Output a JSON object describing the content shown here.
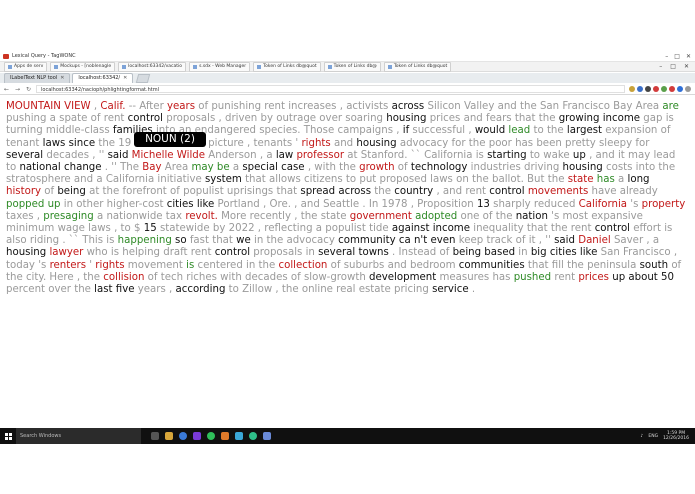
{
  "window": {
    "title": "Lexical Query - TagWONC"
  },
  "bookmarks": [
    {
      "label": "Apps de serv"
    },
    {
      "label": "Mockups - [noblenagle"
    },
    {
      "label": "localhost:63342/vacatio"
    },
    {
      "label": "s.sdx - Web Manager"
    },
    {
      "label": "Token of Links db@quot"
    },
    {
      "label": "Token of Links db@"
    },
    {
      "label": "Token of Links db@quot"
    }
  ],
  "tabs": [
    {
      "label": "lLabelText NLP tool"
    },
    {
      "label": "localhost:63342/"
    }
  ],
  "address": {
    "url": "localhost:63342/nacioph/phlightingformat.html"
  },
  "tooltip": {
    "text": "NOUN (2)"
  },
  "taskbar": {
    "search_placeholder": "Search Windows",
    "time": "1:59 PM",
    "date": "12/26/2016",
    "lang": "ENG"
  },
  "colors": {
    "noun": "#c21818",
    "verb": "#2e8a26",
    "other": "#9a9a9a",
    "key": "#111111"
  },
  "article": {
    "tokens": [
      {
        "t": "MOUNTAIN VIEW",
        "c": "r"
      },
      {
        "t": " , ",
        "c": "g"
      },
      {
        "t": "Calif.",
        "c": "r"
      },
      {
        "t": " -- After ",
        "c": "g"
      },
      {
        "t": "years",
        "c": "r"
      },
      {
        "t": " of punishing rent increases , activists ",
        "c": "g"
      },
      {
        "t": "across",
        "c": "k"
      },
      {
        "t": " Silicon Valley and the San Francisco Bay Area ",
        "c": "g"
      },
      {
        "t": "are",
        "c": "gr"
      },
      {
        "t": " pushing a spate of rent ",
        "c": "g"
      },
      {
        "t": "control",
        "c": "k"
      },
      {
        "t": " proposals , driven by outrage over soaring ",
        "c": "g"
      },
      {
        "t": "housing",
        "c": "k"
      },
      {
        "t": " prices and fears that the ",
        "c": "g"
      },
      {
        "t": "growing",
        "c": "k"
      },
      {
        "t": " ",
        "c": "g"
      },
      {
        "t": "income",
        "c": "k"
      },
      {
        "t": " gap is",
        "c": "g"
      },
      {
        "t": " turning middle-class ",
        "c": "g"
      },
      {
        "t": "families",
        "c": "k"
      },
      {
        "t": " into an endangered species. Those campaigns , ",
        "c": "g"
      },
      {
        "t": "if",
        "c": "k"
      },
      {
        "t": " successful , ",
        "c": "g"
      },
      {
        "t": "would",
        "c": "k"
      },
      {
        "t": " ",
        "c": "g"
      },
      {
        "t": "lead",
        "c": "gr"
      },
      {
        "t": " to the ",
        "c": "g"
      },
      {
        "t": "largest",
        "c": "k"
      },
      {
        "t": " expansion of",
        "c": "g"
      },
      {
        "t": " tenant ",
        "c": "g"
      },
      {
        "t": "laws",
        "c": "k"
      },
      {
        "t": " ",
        "c": "g"
      },
      {
        "t": "since",
        "c": "k"
      },
      {
        "t": " the 19",
        "c": "g"
      },
      {
        "t": "          ",
        "c": "g"
      },
      {
        "t": "national picture , tenants ' ",
        "c": "g"
      },
      {
        "t": "rights",
        "c": "r"
      },
      {
        "t": " and ",
        "c": "g"
      },
      {
        "t": "housing",
        "c": "k"
      },
      {
        "t": " advocacy for the poor has been pretty sleepy",
        "c": "g"
      },
      {
        "t": " for ",
        "c": "g"
      },
      {
        "t": "several",
        "c": "k"
      },
      {
        "t": " decades , '' ",
        "c": "g"
      },
      {
        "t": "said",
        "c": "k"
      },
      {
        "t": " ",
        "c": "g"
      },
      {
        "t": "Michelle Wilde",
        "c": "r"
      },
      {
        "t": " Anderson , a ",
        "c": "g"
      },
      {
        "t": "law",
        "c": "k"
      },
      {
        "t": " ",
        "c": "g"
      },
      {
        "t": "professor",
        "c": "r"
      },
      {
        "t": " at Stanford. `` California is ",
        "c": "g"
      },
      {
        "t": "starting",
        "c": "k"
      },
      {
        "t": " to wake ",
        "c": "g"
      },
      {
        "t": "up",
        "c": "k"
      },
      {
        "t": " , and it may",
        "c": "g"
      },
      {
        "t": " lead to ",
        "c": "g"
      },
      {
        "t": "national",
        "c": "k"
      },
      {
        "t": " ",
        "c": "g"
      },
      {
        "t": "change",
        "c": "k"
      },
      {
        "t": " . '' The ",
        "c": "g"
      },
      {
        "t": "Bay",
        "c": "r"
      },
      {
        "t": " Area ",
        "c": "g"
      },
      {
        "t": "may be",
        "c": "gr"
      },
      {
        "t": " a ",
        "c": "g"
      },
      {
        "t": "special",
        "c": "k"
      },
      {
        "t": " ",
        "c": "g"
      },
      {
        "t": "case",
        "c": "k"
      },
      {
        "t": " , with the ",
        "c": "g"
      },
      {
        "t": "growth",
        "c": "r"
      },
      {
        "t": " of ",
        "c": "g"
      },
      {
        "t": "technology",
        "c": "k"
      },
      {
        "t": " industries driving ",
        "c": "g"
      },
      {
        "t": "housing",
        "c": "k"
      },
      {
        "t": " costs into",
        "c": "g"
      },
      {
        "t": " the stratosphere and a California initiative ",
        "c": "g"
      },
      {
        "t": "system",
        "c": "k"
      },
      {
        "t": " that allows citizens to put proposed laws on the ballot. But the ",
        "c": "g"
      },
      {
        "t": "state",
        "c": "r"
      },
      {
        "t": " ",
        "c": "g"
      },
      {
        "t": "has",
        "c": "gr"
      },
      {
        "t": " a ",
        "c": "g"
      },
      {
        "t": "long",
        "c": "k"
      },
      {
        "t": " ",
        "c": "g"
      },
      {
        "t": "history",
        "c": "r"
      },
      {
        "t": " of ",
        "c": "g"
      },
      {
        "t": "being",
        "c": "k"
      },
      {
        "t": " at the forefront of populist uprisings that ",
        "c": "g"
      },
      {
        "t": "spread",
        "c": "k"
      },
      {
        "t": " ",
        "c": "g"
      },
      {
        "t": "across",
        "c": "k"
      },
      {
        "t": " the ",
        "c": "g"
      },
      {
        "t": "country",
        "c": "k"
      },
      {
        "t": " , and rent ",
        "c": "g"
      },
      {
        "t": "control",
        "c": "k"
      },
      {
        "t": " ",
        "c": "g"
      },
      {
        "t": "movements",
        "c": "r"
      },
      {
        "t": " have already",
        "c": "g"
      },
      {
        "t": " ",
        "c": "g"
      },
      {
        "t": "popped up",
        "c": "gr"
      },
      {
        "t": " in other higher-cost ",
        "c": "g"
      },
      {
        "t": "cities",
        "c": "k"
      },
      {
        "t": " ",
        "c": "g"
      },
      {
        "t": "like",
        "c": "k"
      },
      {
        "t": " Portland , Ore. , and Seattle . In 1978 , Proposition ",
        "c": "g"
      },
      {
        "t": "13",
        "c": "k"
      },
      {
        "t": " sharply reduced ",
        "c": "g"
      },
      {
        "t": "California",
        "c": "r"
      },
      {
        "t": " 's ",
        "c": "g"
      },
      {
        "t": "property",
        "c": "r"
      },
      {
        "t": " taxes , ",
        "c": "g"
      },
      {
        "t": "presaging",
        "c": "gr"
      },
      {
        "t": " a nationwide tax ",
        "c": "g"
      },
      {
        "t": "revolt.",
        "c": "r"
      },
      {
        "t": " More recently , the state ",
        "c": "g"
      },
      {
        "t": "government",
        "c": "r"
      },
      {
        "t": " ",
        "c": "g"
      },
      {
        "t": "adopted",
        "c": "gr"
      },
      {
        "t": " one of the ",
        "c": "g"
      },
      {
        "t": "nation",
        "c": "k"
      },
      {
        "t": " 's most expansive",
        "c": "g"
      },
      {
        "t": " minimum wage laws , to $ ",
        "c": "g"
      },
      {
        "t": "15",
        "c": "k"
      },
      {
        "t": " statewide by 2022 , reflecting a populist tide ",
        "c": "g"
      },
      {
        "t": "against",
        "c": "k"
      },
      {
        "t": " ",
        "c": "g"
      },
      {
        "t": "income",
        "c": "k"
      },
      {
        "t": " inequality that the rent ",
        "c": "g"
      },
      {
        "t": "control",
        "c": "k"
      },
      {
        "t": " effort is",
        "c": "g"
      },
      {
        "t": " also riding . `` This is ",
        "c": "g"
      },
      {
        "t": "happening",
        "c": "gr"
      },
      {
        "t": " ",
        "c": "g"
      },
      {
        "t": "so",
        "c": "k"
      },
      {
        "t": " fast that ",
        "c": "g"
      },
      {
        "t": "we",
        "c": "k"
      },
      {
        "t": " in the advocacy ",
        "c": "g"
      },
      {
        "t": "community",
        "c": "k"
      },
      {
        "t": " ",
        "c": "g"
      },
      {
        "t": "ca n't",
        "c": "k"
      },
      {
        "t": " ",
        "c": "g"
      },
      {
        "t": "even",
        "c": "k"
      },
      {
        "t": " keep track of it , '' ",
        "c": "g"
      },
      {
        "t": "said",
        "c": "k"
      },
      {
        "t": " ",
        "c": "g"
      },
      {
        "t": "Daniel",
        "c": "r"
      },
      {
        "t": " Saver , a",
        "c": "g"
      },
      {
        "t": " ",
        "c": "g"
      },
      {
        "t": "housing",
        "c": "k"
      },
      {
        "t": " ",
        "c": "g"
      },
      {
        "t": "lawyer",
        "c": "r"
      },
      {
        "t": " who is helping draft rent ",
        "c": "g"
      },
      {
        "t": "control",
        "c": "k"
      },
      {
        "t": " proposals in ",
        "c": "g"
      },
      {
        "t": "several towns",
        "c": "k"
      },
      {
        "t": " . Instead of ",
        "c": "g"
      },
      {
        "t": "being based",
        "c": "k"
      },
      {
        "t": " in ",
        "c": "g"
      },
      {
        "t": "big cities like",
        "c": "k"
      },
      {
        "t": " San Francisco ,",
        "c": "g"
      },
      {
        "t": " today 's ",
        "c": "g"
      },
      {
        "t": "renters",
        "c": "r"
      },
      {
        "t": " ' ",
        "c": "g"
      },
      {
        "t": "rights",
        "c": "r"
      },
      {
        "t": " movement ",
        "c": "g"
      },
      {
        "t": "is",
        "c": "gr"
      },
      {
        "t": " centered in the ",
        "c": "g"
      },
      {
        "t": "collection",
        "c": "r"
      },
      {
        "t": " of suburbs and bedroom ",
        "c": "g"
      },
      {
        "t": "communities",
        "c": "k"
      },
      {
        "t": " that fill the peninsula ",
        "c": "g"
      },
      {
        "t": "south",
        "c": "k"
      },
      {
        "t": " of",
        "c": "g"
      },
      {
        "t": " the city. Here , the ",
        "c": "g"
      },
      {
        "t": "collision",
        "c": "r"
      },
      {
        "t": " of tech riches with decades of slow-growth ",
        "c": "g"
      },
      {
        "t": "development",
        "c": "k"
      },
      {
        "t": " measures has ",
        "c": "g"
      },
      {
        "t": "pushed",
        "c": "gr"
      },
      {
        "t": " rent ",
        "c": "g"
      },
      {
        "t": "prices",
        "c": "r"
      },
      {
        "t": " ",
        "c": "g"
      },
      {
        "t": "up about 50",
        "c": "k"
      },
      {
        "t": " percent over the ",
        "c": "g"
      },
      {
        "t": "last five",
        "c": "k"
      },
      {
        "t": " years , ",
        "c": "g"
      },
      {
        "t": "according",
        "c": "k"
      },
      {
        "t": " to Zillow , the ",
        "c": "g"
      },
      {
        "t": "online real estate pricing",
        "c": "g"
      },
      {
        "t": " ",
        "c": "g"
      },
      {
        "t": "service",
        "c": "k"
      },
      {
        "t": " .",
        "c": "g"
      }
    ]
  }
}
